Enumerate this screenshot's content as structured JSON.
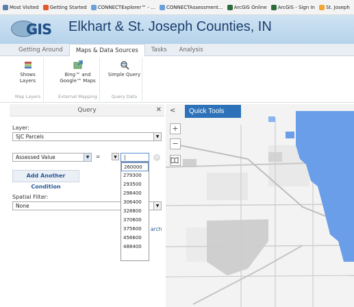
{
  "bookmarks": [
    {
      "label": "Most Visited",
      "color": "#5b7fa8"
    },
    {
      "label": "Getting Started",
      "color": "#e05a2b"
    },
    {
      "label": "CONNECTExplorer™ - ...",
      "color": "#6ca0d8"
    },
    {
      "label": "CONNECTAssessment...",
      "color": "#6ca0d8"
    },
    {
      "label": "ArcGIS Online",
      "color": "#2f6b3a"
    },
    {
      "label": "ArcGIS - Sign In",
      "color": "#2f6b3a"
    },
    {
      "label": "St. Joseph",
      "color": "#f2a531"
    }
  ],
  "header": {
    "logo_text": "GIS",
    "title": "Elkhart & St. Joseph Counties, IN"
  },
  "ribbon_tabs": [
    {
      "label": "Getting Around",
      "active": false
    },
    {
      "label": "Maps & Data Sources",
      "active": true
    },
    {
      "label": "Tasks",
      "active": false
    },
    {
      "label": "Analysis",
      "active": false
    }
  ],
  "ribbon": {
    "groups": [
      {
        "button": "Shows Layers",
        "group_label": "Map Layers",
        "icon": "layers-icon"
      },
      {
        "button": "Bing™ and Google™ Maps",
        "group_label": "External Mapping",
        "icon": "external-map-icon"
      },
      {
        "button": "Simple Query",
        "group_label": "Query Data",
        "icon": "query-icon"
      }
    ]
  },
  "panel": {
    "title": "Query",
    "layer_label": "Layer:",
    "layer_value": "SJC Parcels",
    "field_value": "Assessed Value",
    "operator_value": "=",
    "value_input": "|",
    "add_condition": "Add Another Condition",
    "spatial_label": "Spatial Filter:",
    "spatial_value": "None",
    "search_partial": "arch",
    "value_options": [
      "260000",
      "279300",
      "293500",
      "298400",
      "306400",
      "328800",
      "370600",
      "375600",
      "456600",
      "488400"
    ],
    "selected_option": "260000"
  },
  "map": {
    "quick_tools": "Quick Tools",
    "zoom_in": "+",
    "zoom_out": "−",
    "collapse": "<"
  },
  "colors": {
    "accent": "#2d72b8",
    "urban": "#6a9ee8",
    "roads": "#c8c8c8"
  }
}
